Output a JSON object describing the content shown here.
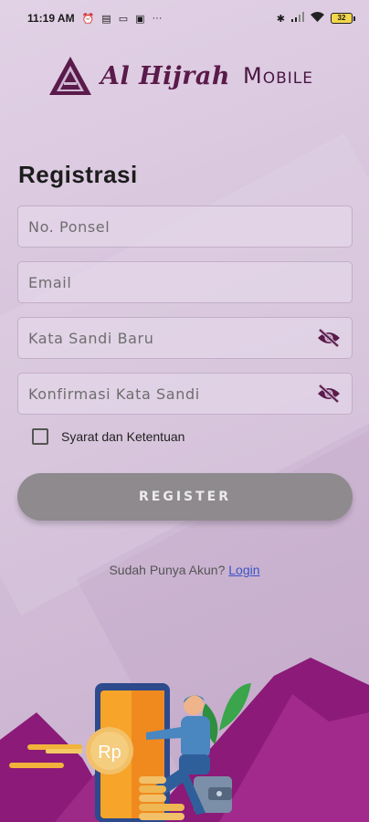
{
  "status_bar": {
    "time": "11:19 AM",
    "left_icons": [
      "alarm-icon",
      "message-icon",
      "laptop-icon",
      "notification-icon",
      "more-icon"
    ],
    "right_icons": [
      "bluetooth-icon",
      "signal-icon",
      "wifi-icon"
    ],
    "battery": "32"
  },
  "logo": {
    "script_text": "Al Hijrah",
    "mobile_text": "Mobile"
  },
  "page": {
    "title": "Registrasi"
  },
  "form": {
    "phone_placeholder": "No. Ponsel",
    "email_placeholder": "Email",
    "password_placeholder": "Kata Sandi Baru",
    "confirm_placeholder": "Konfirmasi Kata Sandi",
    "terms_label": "Syarat dan Ketentuan",
    "terms_checked": false,
    "register_label": "REGISTER"
  },
  "login": {
    "prompt": "Sudah Punya Akun?",
    "link": "Login"
  },
  "illustration": {
    "coin_label": "Rp"
  },
  "colors": {
    "brand": "#5a1a4a",
    "button": "#8e8a8e",
    "link": "#3b52c8",
    "mountain": "#8b1a78"
  }
}
